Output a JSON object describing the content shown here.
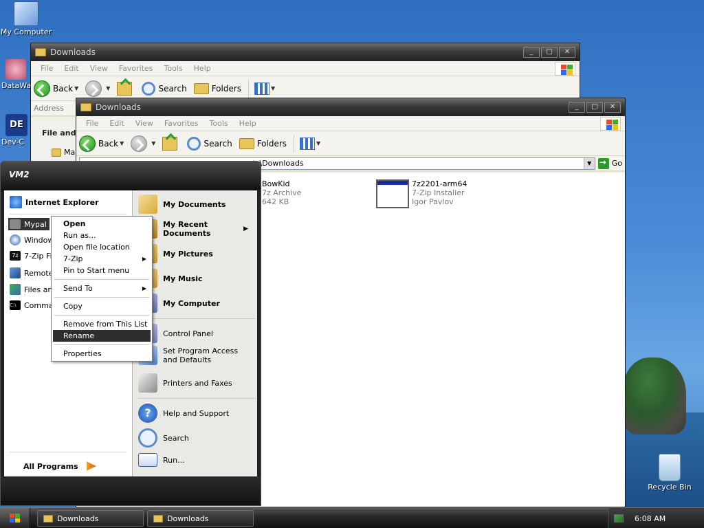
{
  "desktop": {
    "icons": [
      {
        "label": "My Computer"
      },
      {
        "label": "DataWa"
      },
      {
        "label": "Dev-C"
      },
      {
        "label": "Recycle Bin"
      }
    ]
  },
  "back_window": {
    "title": "Downloads",
    "menu": [
      "File",
      "Edit",
      "View",
      "Favorites",
      "Tools",
      "Help"
    ],
    "toolbar": {
      "back": "Back",
      "search": "Search",
      "folders": "Folders"
    },
    "address_label": "Address",
    "tasks_header": "File and",
    "task_item": "Ma"
  },
  "front_window": {
    "title": "Downloads",
    "menu": [
      "File",
      "Edit",
      "View",
      "Favorites",
      "Tools",
      "Help"
    ],
    "toolbar": {
      "back": "Back",
      "search": "Search",
      "folders": "Folders"
    },
    "address_value": "uments\\Downloads",
    "go_label": "Go",
    "files": [
      {
        "name": "BowKid",
        "type": "7z Archive",
        "size": "642 KB"
      },
      {
        "name": "7z2201-arm64",
        "type": "7-Zip Installer",
        "publisher": "Igor Pavlov"
      }
    ]
  },
  "start_menu": {
    "user": "VM2",
    "left_items": [
      {
        "label": "Internet Explorer"
      },
      {
        "label": "Mypal"
      },
      {
        "label": "Window"
      },
      {
        "label": "7-Zip File"
      },
      {
        "label": "Remote"
      },
      {
        "label": "Files and"
      },
      {
        "label": "Comman"
      }
    ],
    "all_programs": "All Programs",
    "right_items": [
      {
        "label": "My Documents"
      },
      {
        "label": "My Recent Documents"
      },
      {
        "label": "My Pictures"
      },
      {
        "label": "My Music"
      },
      {
        "label": "My Computer"
      },
      {
        "label": "Control Panel"
      },
      {
        "label": "Set Program Access and Defaults"
      },
      {
        "label": "Printers and Faxes"
      },
      {
        "label": "Help and Support"
      },
      {
        "label": "Search"
      },
      {
        "label": "Run..."
      }
    ]
  },
  "context_menu": {
    "items": [
      "Open",
      "Run as...",
      "Open file location",
      "7-Zip",
      "Pin to Start menu",
      "Send To",
      "Copy",
      "Remove from This List",
      "Rename",
      "Properties"
    ]
  },
  "taskbar": {
    "tasks": [
      "Downloads",
      "Downloads"
    ],
    "clock": "6:08 AM"
  }
}
